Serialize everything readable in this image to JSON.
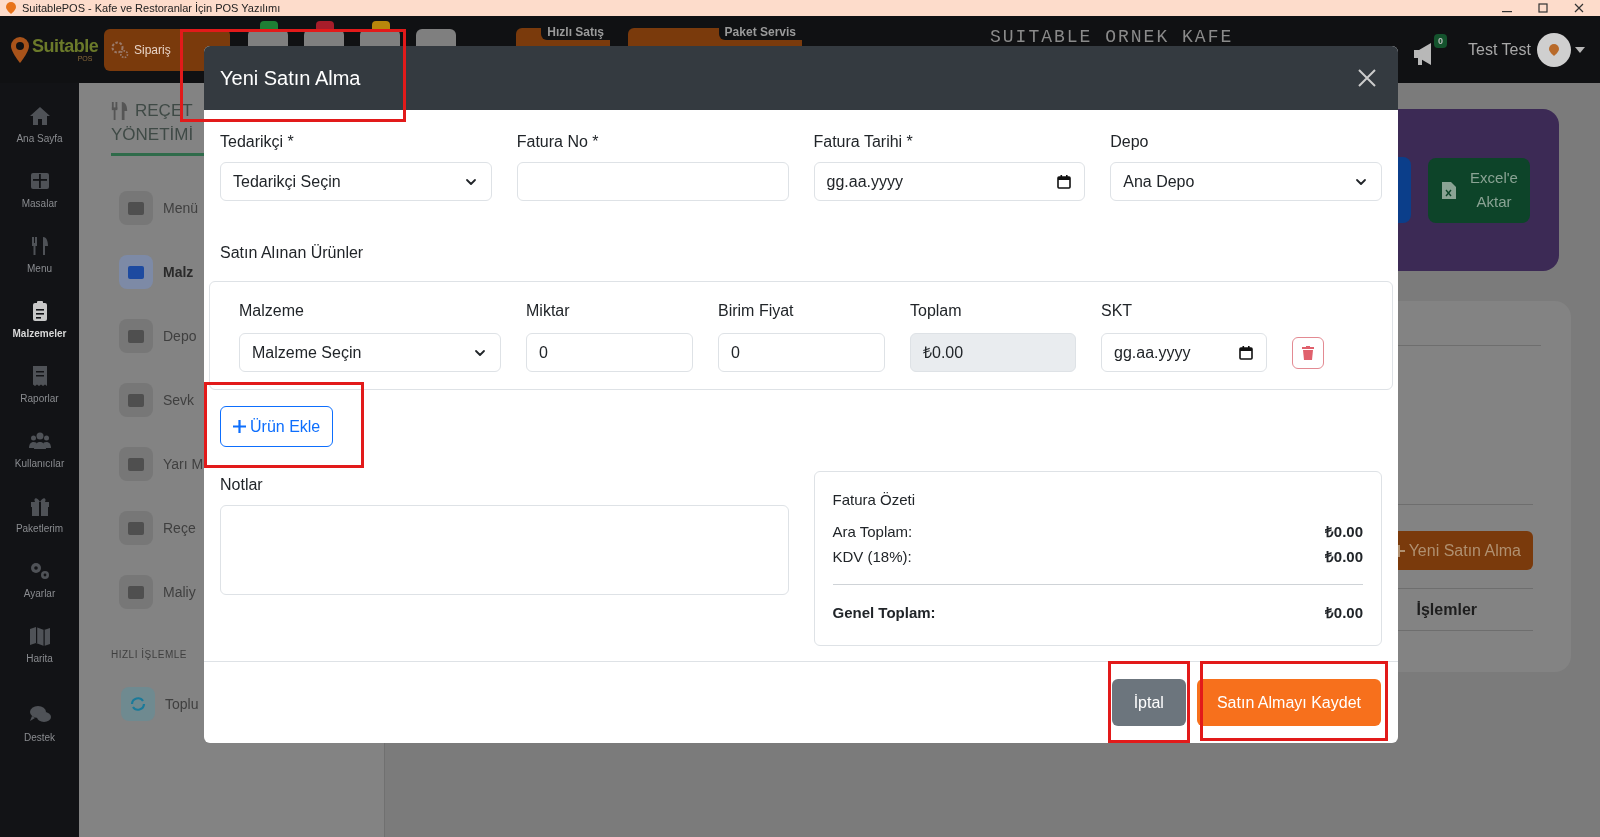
{
  "window": {
    "title": "SuitablePOS - Kafe ve Restoranlar İçin POS Yazılımı"
  },
  "top_bar": {
    "brand": "Suitable",
    "brand_sub": "POS",
    "orders_button": "Sipariş",
    "icon_buttons": [
      {
        "kind": "badged",
        "color": "#1e7e34"
      },
      {
        "kind": "badged",
        "color": "#a71d2a"
      },
      {
        "kind": "badged",
        "color": "#b8860b"
      },
      {
        "kind": "plain"
      }
    ],
    "mode_buttons": [
      {
        "tab": "Hızlı Satış"
      },
      {
        "tab": "Paket Servis"
      }
    ],
    "shop_name": "SUITABLE ORNEK KAFE",
    "notification_count": "0",
    "user_name": "Test Test"
  },
  "sidebar": {
    "items": [
      {
        "label": "Ana Sayfa",
        "selected": false
      },
      {
        "label": "Masalar",
        "selected": false
      },
      {
        "label": "Menu",
        "selected": false
      },
      {
        "label": "Malzemeler",
        "selected": true
      },
      {
        "label": "Raporlar",
        "selected": false
      },
      {
        "label": "Kullanıcılar",
        "selected": false
      },
      {
        "label": "Paketlerim",
        "selected": false
      },
      {
        "label": "Ayarlar",
        "selected": false
      },
      {
        "label": "Harita",
        "selected": false
      },
      {
        "label": "Destek",
        "selected": false
      }
    ]
  },
  "panel": {
    "title_lines": [
      "REÇET",
      "YÖNETİMİ"
    ],
    "items": [
      {
        "label": "Menü",
        "selected": false
      },
      {
        "label": "Malz",
        "selected": true
      },
      {
        "label": "Depo",
        "selected": false
      },
      {
        "label": "Sevk",
        "selected": false
      },
      {
        "label": "Yarı M",
        "selected": false
      },
      {
        "label": "Reçe",
        "selected": false
      },
      {
        "label": "Maliy",
        "selected": false
      }
    ],
    "section_title": "HIZLI İŞLEMLE",
    "quick_items": [
      "Toplu"
    ]
  },
  "page": {
    "export_button": "Excel'e Aktar",
    "new_purchase_button": "Yeni Satın Alma",
    "table_header": "İşlemler"
  },
  "modal": {
    "title": "Yeni Satın Alma",
    "fields": [
      {
        "label": "Tedarikçi *",
        "kind": "select",
        "value": "Tedarikçi Seçin"
      },
      {
        "label": "Fatura No *",
        "kind": "text"
      },
      {
        "label": "Fatura Tarihi *",
        "kind": "date",
        "placeholder": "gg.aa.yyyy"
      },
      {
        "label": "Depo",
        "kind": "select",
        "value": "Ana Depo"
      }
    ],
    "items_title": "Satın Alınan Ürünler",
    "item_columns": [
      "Malzeme",
      "Miktar",
      "Birim Fiyat",
      "Toplam",
      "SKT"
    ],
    "item_rows": [
      {
        "material": "Malzeme Seçin",
        "quantity": "0",
        "unit_price": "0",
        "total": "₺0.00",
        "expiry_placeholder": "gg.aa.yyyy"
      }
    ],
    "add_button": "Ürün Ekle",
    "notes_label": "Notlar",
    "summary": {
      "title": "Fatura Özeti",
      "lines": [
        {
          "label": "Ara Toplam:",
          "value": "₺0.00"
        },
        {
          "label": "KDV (18%):",
          "value": "₺0.00"
        }
      ],
      "total": {
        "label": "Genel Toplam:",
        "value": "₺0.00"
      }
    },
    "buttons": [
      {
        "kind": "secondary",
        "label": "İptal"
      },
      {
        "kind": "primary",
        "label": "Satın Almayı Kaydet"
      }
    ]
  }
}
